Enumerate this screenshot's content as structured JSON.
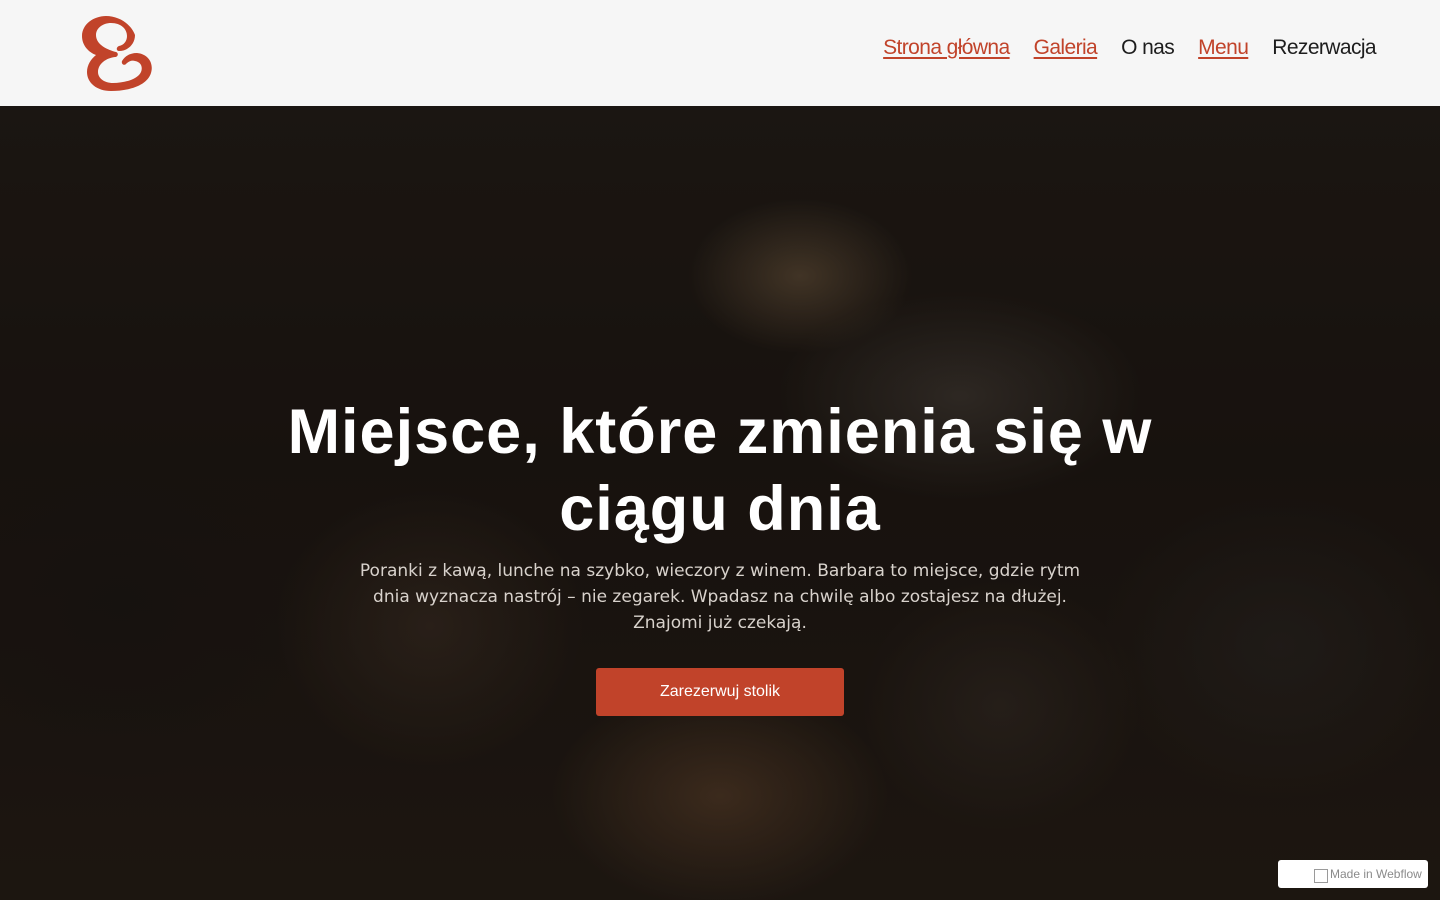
{
  "header": {
    "logo_icon": "barbara-b-logo-icon",
    "nav": [
      {
        "label": "Strona główna",
        "active": true
      },
      {
        "label": "Galeria",
        "active": true
      },
      {
        "label": "O nas",
        "active": false
      },
      {
        "label": "Menu",
        "active": true
      },
      {
        "label": "Rezerwacja",
        "active": false
      }
    ]
  },
  "hero": {
    "title": "Miejsce, które zmienia się w ciągu dnia",
    "subtitle": "Poranki z kawą, lunche na szybko, wieczory z winem. Barbara to miejsce, gdzie rytm dnia wyznacza nastrój – nie zegarek. Wpadasz na chwilę albo zostajesz na dłużej. Znajomi już czekają.",
    "cta_label": "Zarezerwuj stolik"
  },
  "badge": {
    "label": "Made in Webflow",
    "icon": "broken-image-icon"
  },
  "colors": {
    "accent": "#c1432a",
    "header_bg": "#f6f6f6",
    "text_dark": "#1d1d1d"
  }
}
